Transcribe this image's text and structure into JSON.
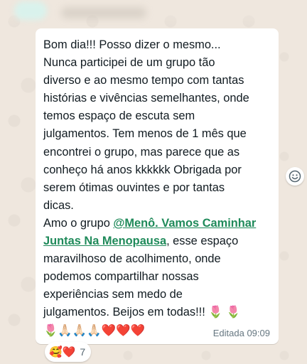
{
  "message": {
    "line1": "Bom dia!!! Posso dizer o mesmo...",
    "line2": "Nunca participei de um grupo tão",
    "line3": "diverso e ao mesmo tempo com tantas",
    "line4": "histórias e vivências semelhantes, onde",
    "line5": "temos espaço de escuta sem",
    "line6": "julgamentos. Tem menos de 1 mês que",
    "line7": "encontrei o grupo, mas parece que as",
    "line8": "conheço há anos kkkkkk Obrigada por",
    "line9": "serem ótimas ouvintes e por tantas",
    "line10": "dicas.",
    "line11_pre": "Amo o grupo ",
    "mention_part1": "@Menô. Vamos Caminhar",
    "mention_part2": "Juntas Na Menopausa",
    "line12_post": ", esse espaço",
    "line13": "maravilhoso de acolhimento, onde",
    "line14": "podemos compartilhar nossas",
    "line15": "experiências sem medo de",
    "line16": "julgamentos. Beijos em todas!!!",
    "emoji_tail_line16": "🌷 🌷",
    "emoji_line17": "🌷🙏🏻🙏🏻🙏🏻❤️❤️❤️"
  },
  "meta": {
    "edited_label": "Editada",
    "time": "09:09"
  },
  "reactions": {
    "emojis": "🥰❤️",
    "count": "7"
  },
  "icons": {
    "react": "smile-icon"
  },
  "colors": {
    "mention": "#1f8a5a",
    "bubble": "#ffffff",
    "background": "#efe7de",
    "meta_text": "#667781"
  }
}
